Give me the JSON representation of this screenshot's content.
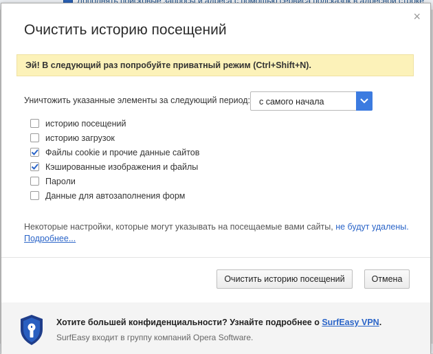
{
  "background": {
    "top_text": "Дополнять поисковые запросы и адреса с помощью сервиса подсказок в адресной строке"
  },
  "dialog": {
    "title": "Очистить историю посещений",
    "close_glyph": "×",
    "notice": "Эй! В следующий раз попробуйте приватный режим (Ctrl+Shift+N).",
    "period": {
      "label": "Уничтожить указанные элементы за следующий период:",
      "selected": "с самого начала"
    },
    "options": [
      {
        "label": "историю посещений",
        "checked": false
      },
      {
        "label": "историю загрузок",
        "checked": false
      },
      {
        "label": "Файлы cookie и прочие данные сайтов",
        "checked": true
      },
      {
        "label": "Кэшированные изображения и файлы",
        "checked": true
      },
      {
        "label": "Пароли",
        "checked": false
      },
      {
        "label": "Данные для автозаполнения форм",
        "checked": false
      }
    ],
    "info": {
      "text": "Некоторые настройки, которые могут указывать на посещаемые вами сайты,",
      "link": "не будут удалены.",
      "more": "Подробнее..."
    },
    "buttons": {
      "clear": "Очистить историю посещений",
      "cancel": "Отмена"
    },
    "footer": {
      "promo_text": "Хотите большей конфиденциальности? Узнайте подробнее о",
      "promo_link": "SurfEasy VPN",
      "promo_end": ".",
      "subtext": "SurfEasy входит в группу компаний Opera Software."
    }
  },
  "colors": {
    "accent": "#3c7be0",
    "link": "#2a64c8",
    "notice_bg": "#fcf2b9",
    "check": "#2a64c8",
    "shield": "#1f3d8a"
  },
  "icons": {
    "close": "close-icon",
    "dropdown": "chevron-down-icon",
    "checkbox": "checkmark-icon",
    "shield": "shield-lock-icon"
  }
}
